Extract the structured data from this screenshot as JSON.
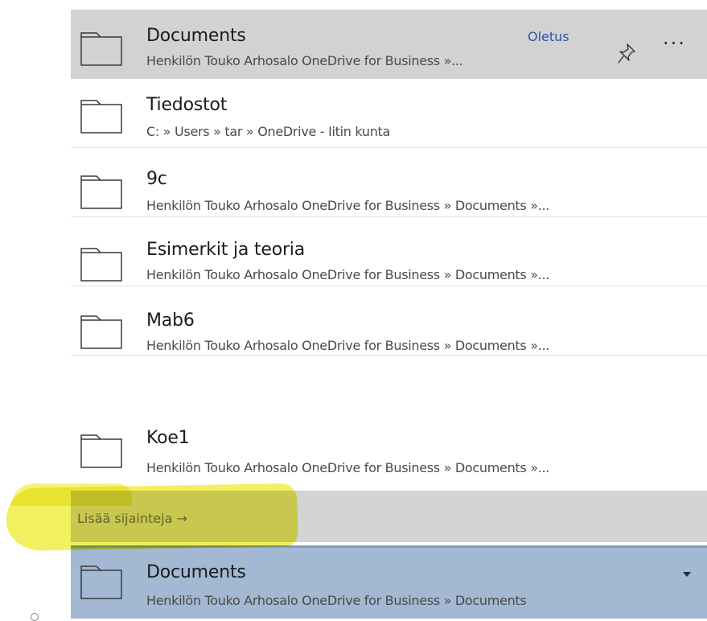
{
  "locations": [
    {
      "title": "Documents",
      "path": "Henkilön Touko Arhosalo OneDrive for Business »...",
      "default_label": "Oletus",
      "pin_icon": "pin-icon",
      "more_label": "···"
    },
    {
      "title": "Tiedostot",
      "path": "C: » Users » tar » OneDrive - Iitin kunta"
    },
    {
      "title": "9c",
      "path": "Henkilön Touko Arhosalo OneDrive for Business » Documents »..."
    },
    {
      "title": "Esimerkit ja teoria",
      "path": "Henkilön Touko Arhosalo OneDrive for Business » Documents »..."
    },
    {
      "title": "Mab6",
      "path": "Henkilön Touko Arhosalo OneDrive for Business » Documents »..."
    },
    {
      "title": "Koe1",
      "path": "Henkilön Touko Arhosalo OneDrive for Business » Documents »..."
    }
  ],
  "more_locations": {
    "label": "Lisää sijainteja →"
  },
  "selected_location": {
    "title": "Documents",
    "path": "Henkilön Touko Arhosalo OneDrive for Business » Documents"
  },
  "colors": {
    "highlight_row": "#d2d2d2",
    "selected_row": "#a3b8d3",
    "link": "#2b57a8",
    "marker": "#eceb28"
  }
}
